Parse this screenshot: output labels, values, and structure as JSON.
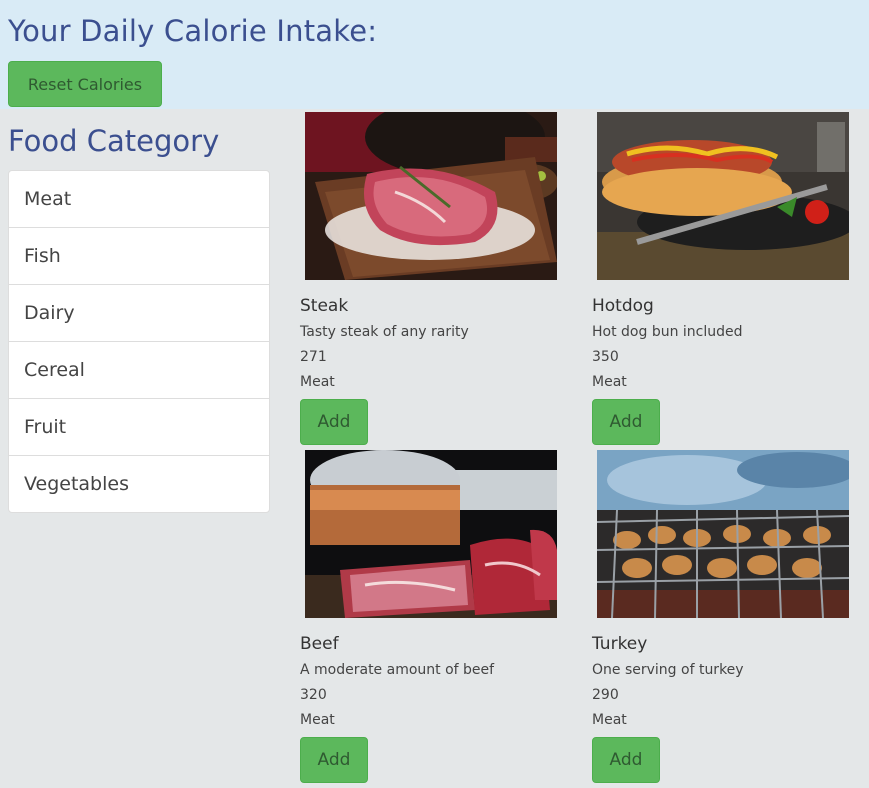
{
  "header": {
    "title": "Your Daily Calorie Intake:",
    "reset_label": "Reset Calories"
  },
  "sidebar": {
    "title": "Food Category",
    "categories": [
      "Meat",
      "Fish",
      "Dairy",
      "Cereal",
      "Fruit",
      "Vegetables"
    ]
  },
  "foods": [
    {
      "name": "Steak",
      "description": "Tasty steak of any rarity",
      "calories": "271",
      "category": "Meat",
      "add_label": "Add"
    },
    {
      "name": "Hotdog",
      "description": "Hot dog bun included",
      "calories": "350",
      "category": "Meat",
      "add_label": "Add"
    },
    {
      "name": "Beef",
      "description": "A moderate amount of beef",
      "calories": "320",
      "category": "Meat",
      "add_label": "Add"
    },
    {
      "name": "Turkey",
      "description": "One serving of turkey",
      "calories": "290",
      "category": "Meat",
      "add_label": "Add"
    }
  ],
  "colors": {
    "header_bg": "#d9ebf6",
    "page_bg": "#e4e7e8",
    "heading": "#3b4f8f",
    "button_green": "#5cb85c"
  }
}
